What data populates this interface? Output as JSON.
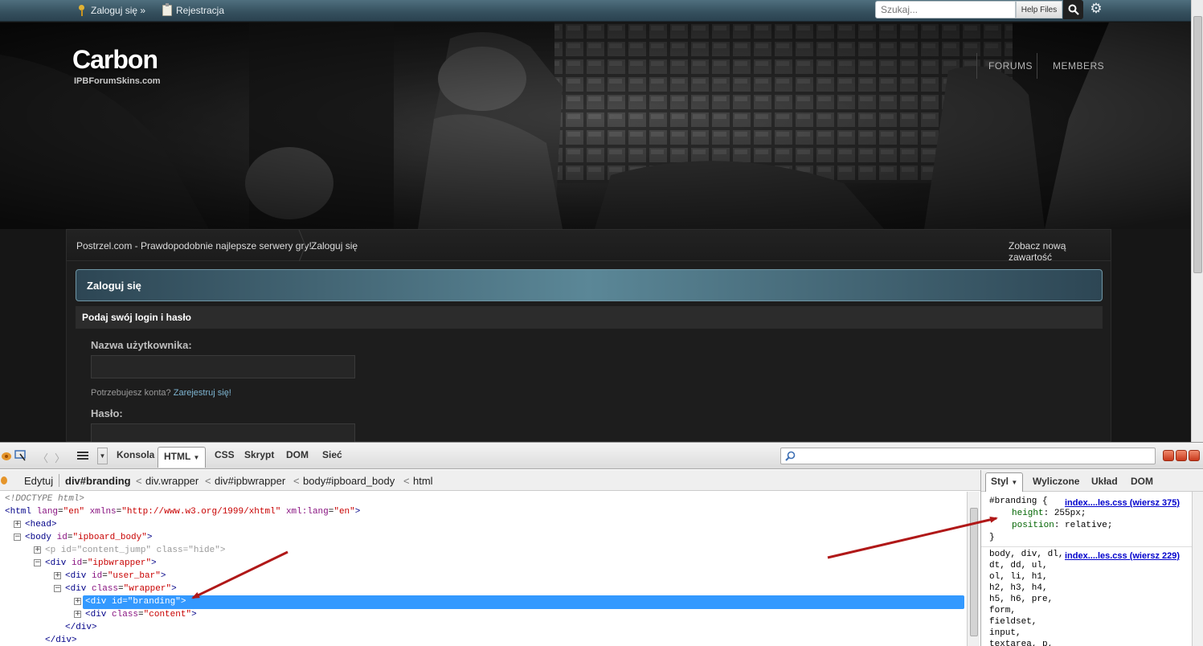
{
  "topbar": {
    "login_label": "Zaloguj się »",
    "register_label": "Rejestracja",
    "search_placeholder": "Szukaj...",
    "help_files_label": "Help Files"
  },
  "header": {
    "logo": "Carbon",
    "logo_sub": "IPBForumSkins.com",
    "nav": [
      "FORUMS",
      "MEMBERS"
    ]
  },
  "breadcrumb": {
    "items": [
      "Postrzel.com - Prawdopodobnie najlepsze serwery gry!",
      "Zaloguj się"
    ],
    "right_link": "Zobacz nową zawartość"
  },
  "login": {
    "title": "Zaloguj się",
    "subtitle": "Podaj swój login i hasło",
    "username_label": "Nazwa użytkownika:",
    "need_account": "Potrzebujesz konta?",
    "register_link": "Zarejestruj się!",
    "password_label": "Hasło:"
  },
  "firebug": {
    "tabs": [
      "Konsola",
      "HTML",
      "CSS",
      "Skrypt",
      "DOM",
      "Sieć"
    ],
    "active_tab": "HTML",
    "edit_label": "Edytuj",
    "crumbs": [
      "div#branding",
      "div.wrapper",
      "div#ipbwrapper",
      "body#ipboard_body",
      "html"
    ],
    "side_tabs": [
      "Styl",
      "Wyliczone",
      "Układ",
      "DOM"
    ],
    "active_side_tab": "Styl",
    "css_rule1": {
      "selector": "#branding {",
      "link": "index....les.css (wiersz 375)",
      "props": [
        {
          "name": "height",
          "value": "255px;"
        },
        {
          "name": "position",
          "value": "relative;"
        }
      ],
      "close": "}"
    },
    "css_rule2": {
      "link": "index....les.css (wiersz 229)",
      "lines": [
        "body, div, dl,",
        "dt, dd, ul,",
        "ol, li, h1,",
        "h2, h3, h4,",
        "h5, h6, pre,",
        "form,",
        "fieldset,",
        "input,",
        "textarea, p,"
      ]
    }
  },
  "colors": {
    "selection": "#3399ff",
    "link": "#7fb6d3",
    "annotation_arrow": "#b01818"
  }
}
